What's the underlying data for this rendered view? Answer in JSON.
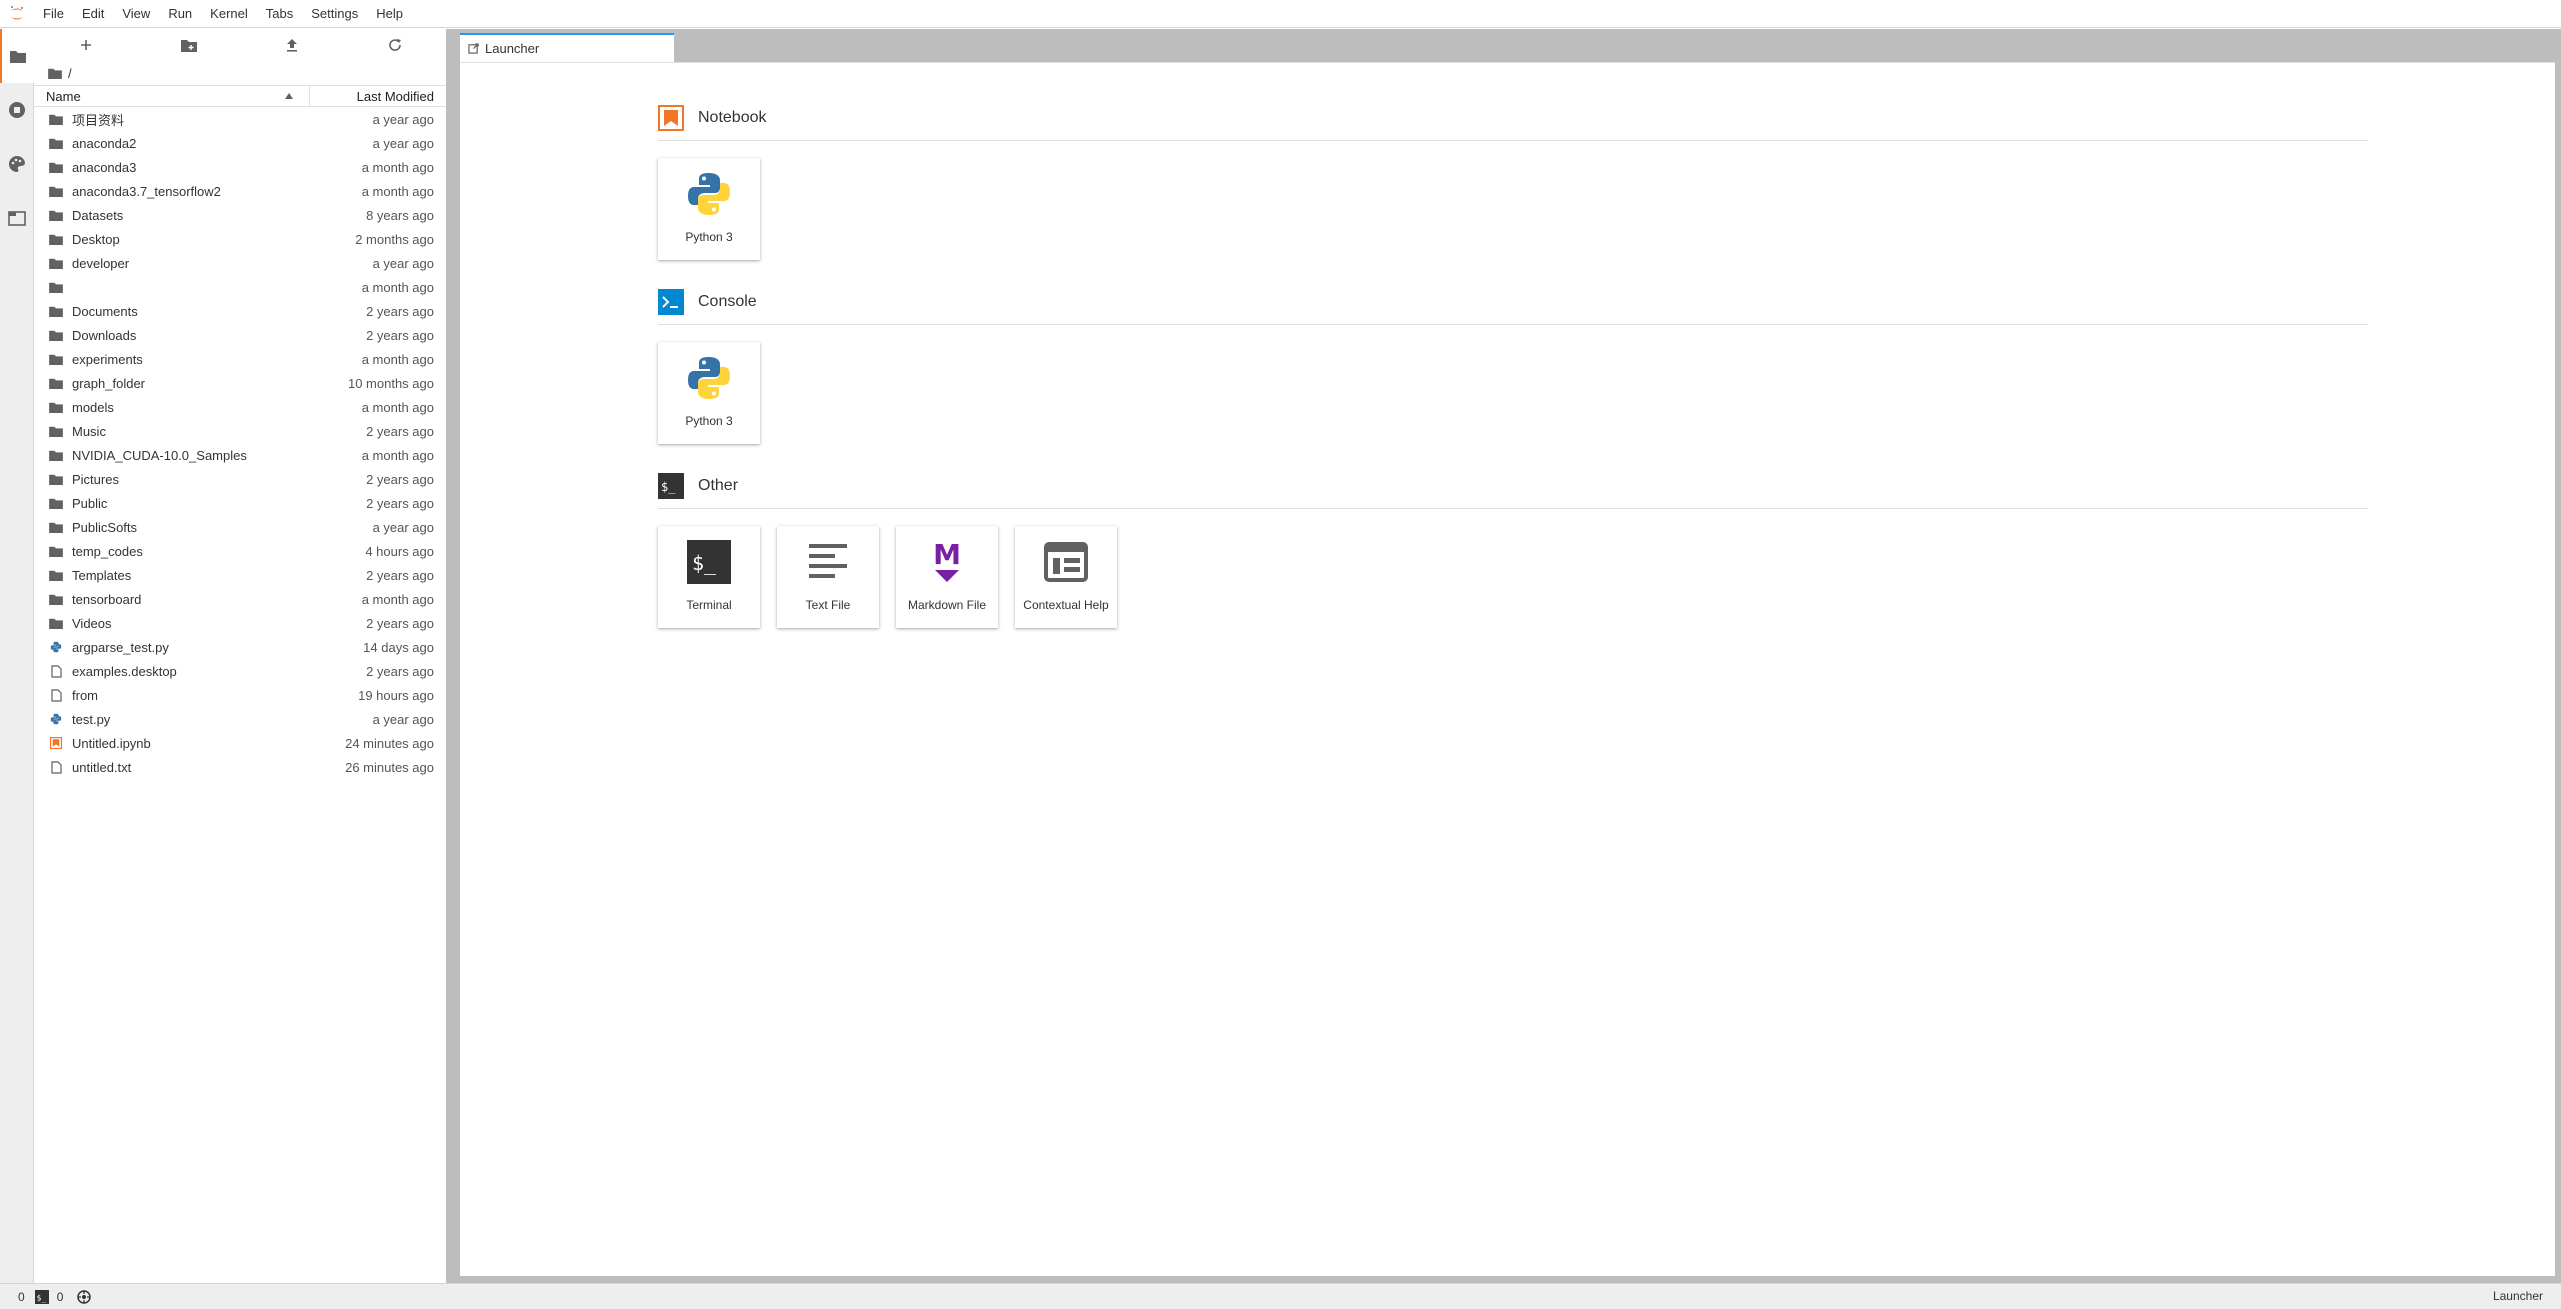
{
  "menubar": {
    "items": [
      "File",
      "Edit",
      "View",
      "Run",
      "Kernel",
      "Tabs",
      "Settings",
      "Help"
    ]
  },
  "filebrowser": {
    "breadcrumb": "/",
    "header_name": "Name",
    "header_modified": "Last Modified",
    "files": [
      {
        "name": "项目资料",
        "modified": "a year ago",
        "type": "folder"
      },
      {
        "name": "anaconda2",
        "modified": "a year ago",
        "type": "folder"
      },
      {
        "name": "anaconda3",
        "modified": "a month ago",
        "type": "folder"
      },
      {
        "name": "anaconda3.7_tensorflow2",
        "modified": "a month ago",
        "type": "folder"
      },
      {
        "name": "Datasets",
        "modified": "8 years ago",
        "type": "folder"
      },
      {
        "name": "Desktop",
        "modified": "2 months ago",
        "type": "folder"
      },
      {
        "name": "developer",
        "modified": "a year ago",
        "type": "folder"
      },
      {
        "name": "",
        "modified": "a month ago",
        "type": "folder"
      },
      {
        "name": "Documents",
        "modified": "2 years ago",
        "type": "folder"
      },
      {
        "name": "Downloads",
        "modified": "2 years ago",
        "type": "folder"
      },
      {
        "name": "experiments",
        "modified": "a month ago",
        "type": "folder"
      },
      {
        "name": "graph_folder",
        "modified": "10 months ago",
        "type": "folder"
      },
      {
        "name": "models",
        "modified": "a month ago",
        "type": "folder"
      },
      {
        "name": "Music",
        "modified": "2 years ago",
        "type": "folder"
      },
      {
        "name": "NVIDIA_CUDA-10.0_Samples",
        "modified": "a month ago",
        "type": "folder"
      },
      {
        "name": "Pictures",
        "modified": "2 years ago",
        "type": "folder"
      },
      {
        "name": "Public",
        "modified": "2 years ago",
        "type": "folder"
      },
      {
        "name": "PublicSofts",
        "modified": "a year ago",
        "type": "folder"
      },
      {
        "name": "temp_codes",
        "modified": "4 hours ago",
        "type": "folder"
      },
      {
        "name": "Templates",
        "modified": "2 years ago",
        "type": "folder"
      },
      {
        "name": "tensorboard",
        "modified": "a month ago",
        "type": "folder"
      },
      {
        "name": "Videos",
        "modified": "2 years ago",
        "type": "folder"
      },
      {
        "name": "argparse_test.py",
        "modified": "14 days ago",
        "type": "python"
      },
      {
        "name": "examples.desktop",
        "modified": "2 years ago",
        "type": "file"
      },
      {
        "name": "from",
        "modified": "19 hours ago",
        "type": "file"
      },
      {
        "name": "test.py",
        "modified": "a year ago",
        "type": "python"
      },
      {
        "name": "Untitled.ipynb",
        "modified": "24 minutes ago",
        "type": "notebook"
      },
      {
        "name": "untitled.txt",
        "modified": "26 minutes ago",
        "type": "file"
      }
    ]
  },
  "tabs": {
    "launcher_label": "Launcher"
  },
  "launcher": {
    "notebook": {
      "title": "Notebook",
      "cards": [
        {
          "label": "Python 3",
          "icon": "python-icon"
        }
      ]
    },
    "console": {
      "title": "Console",
      "cards": [
        {
          "label": "Python 3",
          "icon": "python-icon"
        }
      ]
    },
    "other": {
      "title": "Other",
      "cards": [
        {
          "label": "Terminal",
          "icon": "terminal-icon"
        },
        {
          "label": "Text File",
          "icon": "text-file-icon"
        },
        {
          "label": "Markdown File",
          "icon": "markdown-icon"
        },
        {
          "label": "Contextual Help",
          "icon": "contextual-help-icon"
        }
      ]
    }
  },
  "statusbar": {
    "kernels": "0",
    "terminals": "0",
    "right_label": "Launcher"
  },
  "colors": {
    "accent_orange": "#f37626",
    "accent_blue": "#2196f3",
    "console_blue": "#0288d1",
    "markdown_purple": "#7b1fa2",
    "python_blue": "#3572a5",
    "python_yellow": "#ffd43b"
  }
}
